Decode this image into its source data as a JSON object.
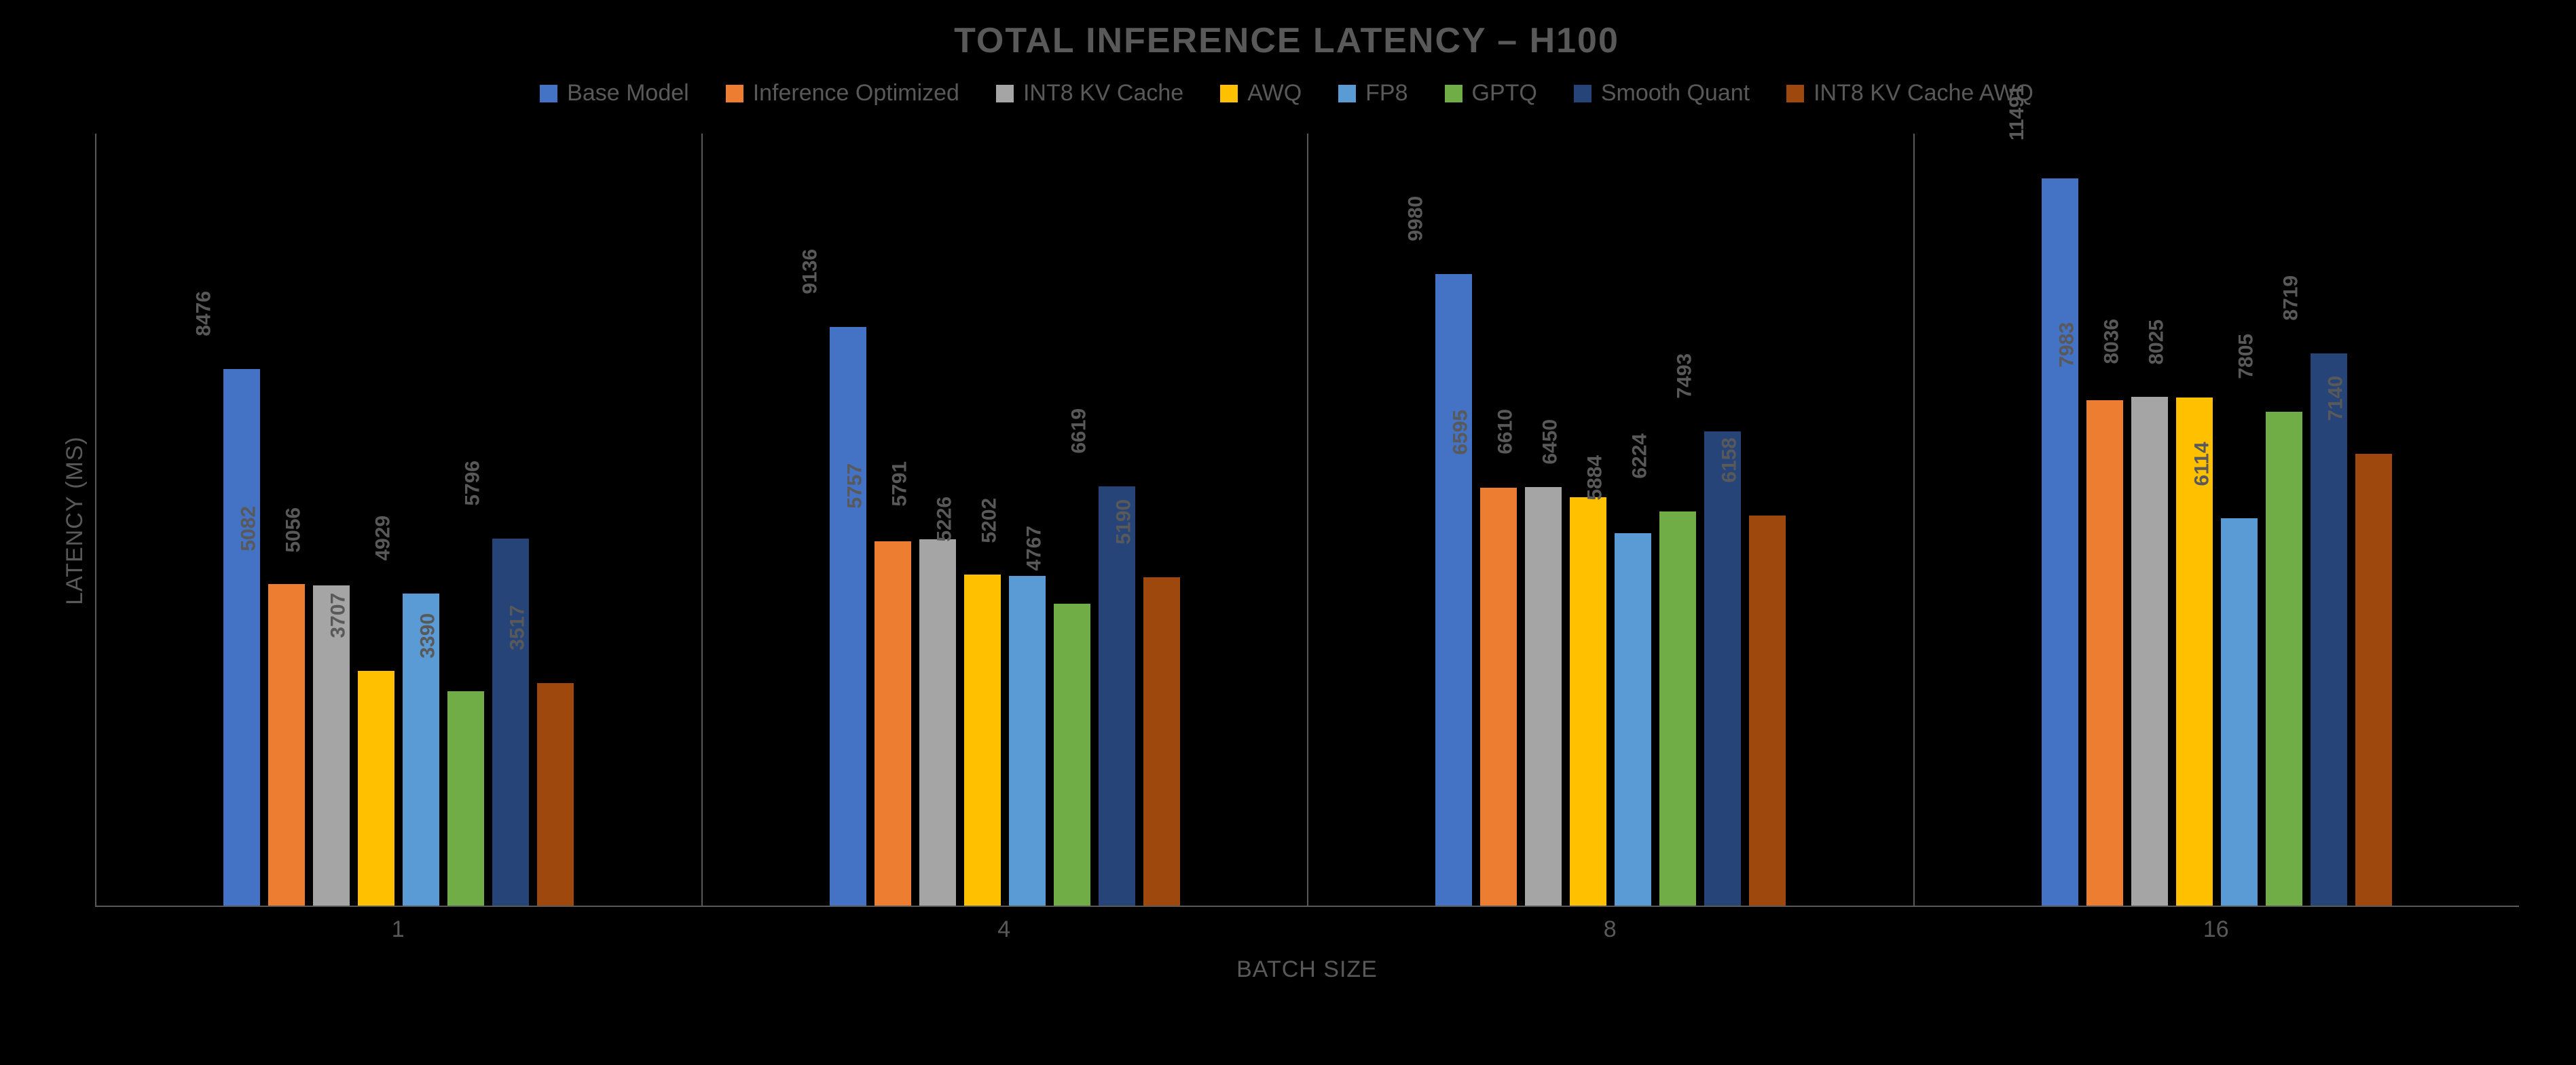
{
  "chart_data": {
    "type": "bar",
    "title": "TOTAL INFERENCE LATENCY – H100",
    "xlabel": "BATCH SIZE",
    "ylabel": "LATENCY (MS)",
    "categories": [
      "1",
      "4",
      "8",
      "16"
    ],
    "ylim": [
      0,
      12000
    ],
    "series": [
      {
        "name": "Base Model",
        "color": "#4472C4",
        "values": [
          8476,
          9136,
          9980,
          11491
        ]
      },
      {
        "name": "Inference Optimized",
        "color": "#ED7D31",
        "values": [
          5082,
          5757,
          6595,
          7983
        ]
      },
      {
        "name": "INT8 KV Cache",
        "color": "#A5A5A5",
        "values": [
          5056,
          5791,
          6610,
          8036
        ]
      },
      {
        "name": "AWQ",
        "color": "#FFC000",
        "values": [
          3707,
          5226,
          6450,
          8025
        ]
      },
      {
        "name": "FP8",
        "color": "#5B9BD5",
        "values": [
          4929,
          5202,
          5884,
          6114
        ]
      },
      {
        "name": "GPTQ",
        "color": "#70AD47",
        "values": [
          3390,
          4767,
          6224,
          7805
        ]
      },
      {
        "name": "Smooth Quant",
        "color": "#264478",
        "values": [
          5796,
          6619,
          7493,
          8719
        ]
      },
      {
        "name": "INT8 KV Cache AWQ",
        "color": "#9E480E",
        "values": [
          3517,
          5190,
          6158,
          7140
        ]
      }
    ]
  }
}
